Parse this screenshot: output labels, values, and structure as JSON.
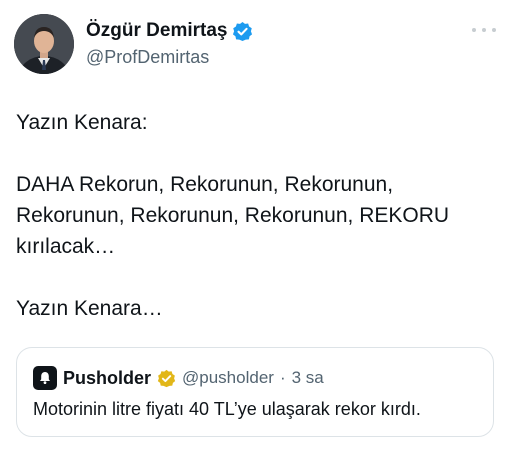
{
  "author": {
    "display_name": "Özgür Demirtaş",
    "handle": "@ProfDemirtas",
    "verified": true,
    "verified_color": "#1d9bf0"
  },
  "tweet": {
    "paragraphs": [
      "Yazın Kenara:",
      "DAHA Rekorun, Rekorunun, Rekorunun, Rekorunun, Rekorunun, Rekorunun, REKORU kırılacak…",
      "Yazın Kenara…"
    ]
  },
  "quoted_tweet": {
    "display_name": "Pusholder",
    "handle": "@pusholder",
    "separator": "·",
    "time": "3 sa",
    "verified_color": "#e2b719",
    "text": "Motorinin litre fiyatı 40 TL’ye ulaşarak rekor kırdı."
  },
  "icons": {
    "more": "more-horizontal-icon",
    "verified": "verified-badge-icon",
    "quote_avatar": "bell-icon"
  }
}
